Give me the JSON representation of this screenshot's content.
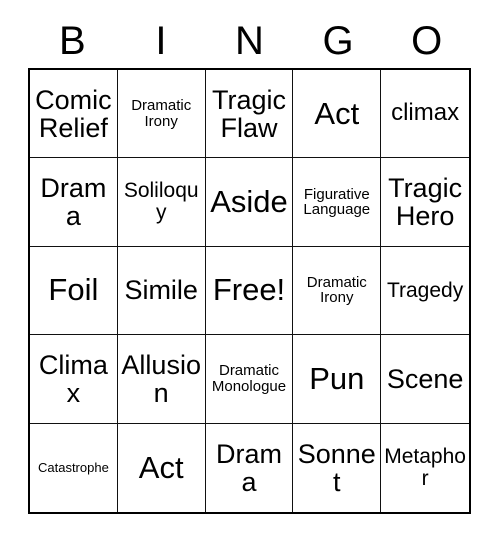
{
  "card": {
    "title": "BINGO",
    "header_letters": [
      "B",
      "I",
      "N",
      "G",
      "O"
    ],
    "colors": {
      "background": "#ffffff",
      "text": "#000000",
      "grid_line": "#111111",
      "outer_border": "#000000"
    },
    "grid": {
      "rows": 5,
      "columns": 5,
      "free_space_index": 12,
      "cells": [
        {
          "label": "Comic Relief",
          "size": "xl"
        },
        {
          "label": "Dramatic Irony",
          "size": "sm"
        },
        {
          "label": "Tragic Flaw",
          "size": "xl"
        },
        {
          "label": "Act",
          "size": "xxl"
        },
        {
          "label": "climax",
          "size": "lg"
        },
        {
          "label": "Drama",
          "size": "xl"
        },
        {
          "label": "Soliloquy",
          "size": "md"
        },
        {
          "label": "Aside",
          "size": "xxl"
        },
        {
          "label": "Figurative Language",
          "size": "sm"
        },
        {
          "label": "Tragic Hero",
          "size": "xl"
        },
        {
          "label": "Foil",
          "size": "xxl"
        },
        {
          "label": "Simile",
          "size": "xl"
        },
        {
          "label": "Free!",
          "size": "xxl"
        },
        {
          "label": "Dramatic Irony",
          "size": "sm"
        },
        {
          "label": "Tragedy",
          "size": "md"
        },
        {
          "label": "Climax",
          "size": "xl"
        },
        {
          "label": "Allusion",
          "size": "xl"
        },
        {
          "label": "Dramatic Monologue",
          "size": "sm"
        },
        {
          "label": "Pun",
          "size": "xxl"
        },
        {
          "label": "Scene",
          "size": "xl"
        },
        {
          "label": "Catastrophe",
          "size": "xs"
        },
        {
          "label": "Act",
          "size": "xxl"
        },
        {
          "label": "Drama",
          "size": "xl"
        },
        {
          "label": "Sonnet",
          "size": "xl"
        },
        {
          "label": "Metaphor",
          "size": "md"
        }
      ]
    }
  }
}
